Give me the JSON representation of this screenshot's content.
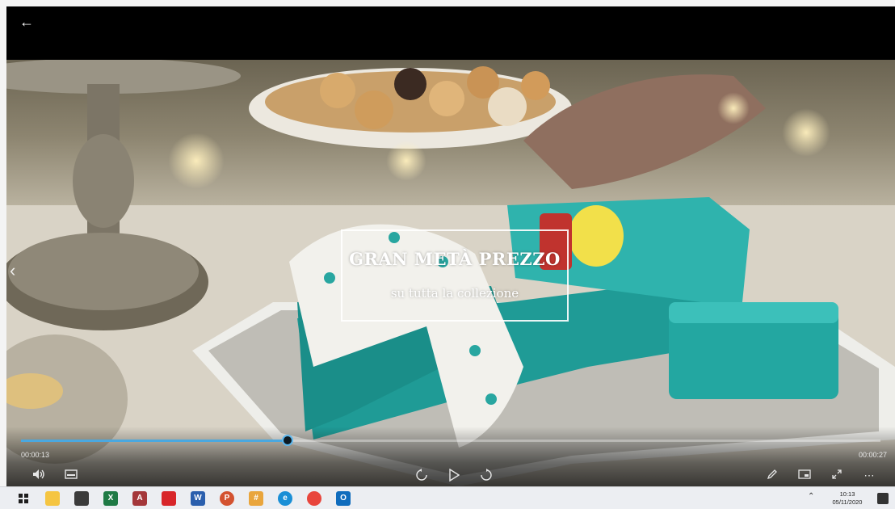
{
  "player": {
    "back_icon": "back-arrow-icon",
    "overlay": {
      "title": "GRAN METÀ PREZZO",
      "subtitle": "su tutta la collezione"
    },
    "progress_fraction": 0.31,
    "time_elapsed": "00:00:13",
    "time_total": "00:00:27",
    "caption": "",
    "controls": {
      "volume_icon": "volume-icon",
      "subtitles_icon": "subtitles-icon",
      "rewind_icon": "rewind-10-icon",
      "play_icon": "play-icon",
      "forward_icon": "forward-30-icon",
      "edit_icon": "pencil-icon",
      "miniplayer_icon": "miniplayer-icon",
      "fullscreen_icon": "fullscreen-icon",
      "more_icon": "more-icon"
    },
    "accent_color": "#4aa8e0"
  },
  "taskbar": {
    "icons": [
      "start-icon",
      "file-explorer-icon",
      "store-icon",
      "excel-icon",
      "access-icon",
      "acrobat-icon",
      "word-icon",
      "powerpoint-icon",
      "slack-icon",
      "edge-icon",
      "chrome-icon",
      "outlook-icon"
    ],
    "clock_time": "10:13",
    "clock_date": "05/11/2020"
  }
}
